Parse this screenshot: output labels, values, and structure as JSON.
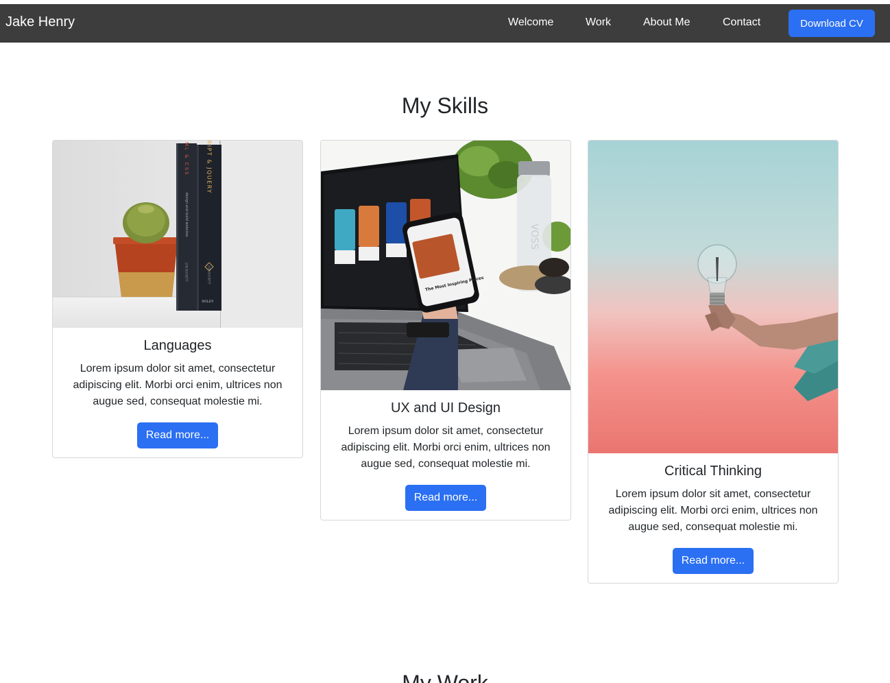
{
  "navbar": {
    "brand": "Jake Henry",
    "links": [
      "Welcome",
      "Work",
      "About Me",
      "Contact"
    ],
    "cv_button": "Download CV"
  },
  "skills": {
    "title": "My Skills",
    "cards": [
      {
        "title": "Languages",
        "text": "Lorem ipsum dolor sit amet, consectetur adipiscing elit. Morbi orci enim, ultrices non augue sed, consequat molestie mi.",
        "button": "Read more...",
        "image": {
          "book1": "HTML & CSS",
          "book1_sub": "design and build websites",
          "book1_author": "JON DUCKETT",
          "book2": "JAVASCRIPT & JQUERY",
          "book2_author": "JON DUCKETT",
          "publisher": "WILEY"
        }
      },
      {
        "title": "UX and UI Design",
        "text": "Lorem ipsum dolor sit amet, consectetur adipiscing elit. Morbi orci enim, ultrices non augue sed, consequat molestie mi.",
        "button": "Read more...",
        "image": {
          "phone_text": "The Most Inspiring Places",
          "bottle_text": "VOSS"
        }
      },
      {
        "title": "Critical Thinking",
        "text": "Lorem ipsum dolor sit amet, consectetur adipiscing elit. Morbi orci enim, ultrices non augue sed, consequat molestie mi.",
        "button": "Read more..."
      }
    ]
  },
  "work": {
    "title": "My Work"
  },
  "colors": {
    "navbar": "#3d3d3d",
    "primary": "#2b6ff2"
  }
}
